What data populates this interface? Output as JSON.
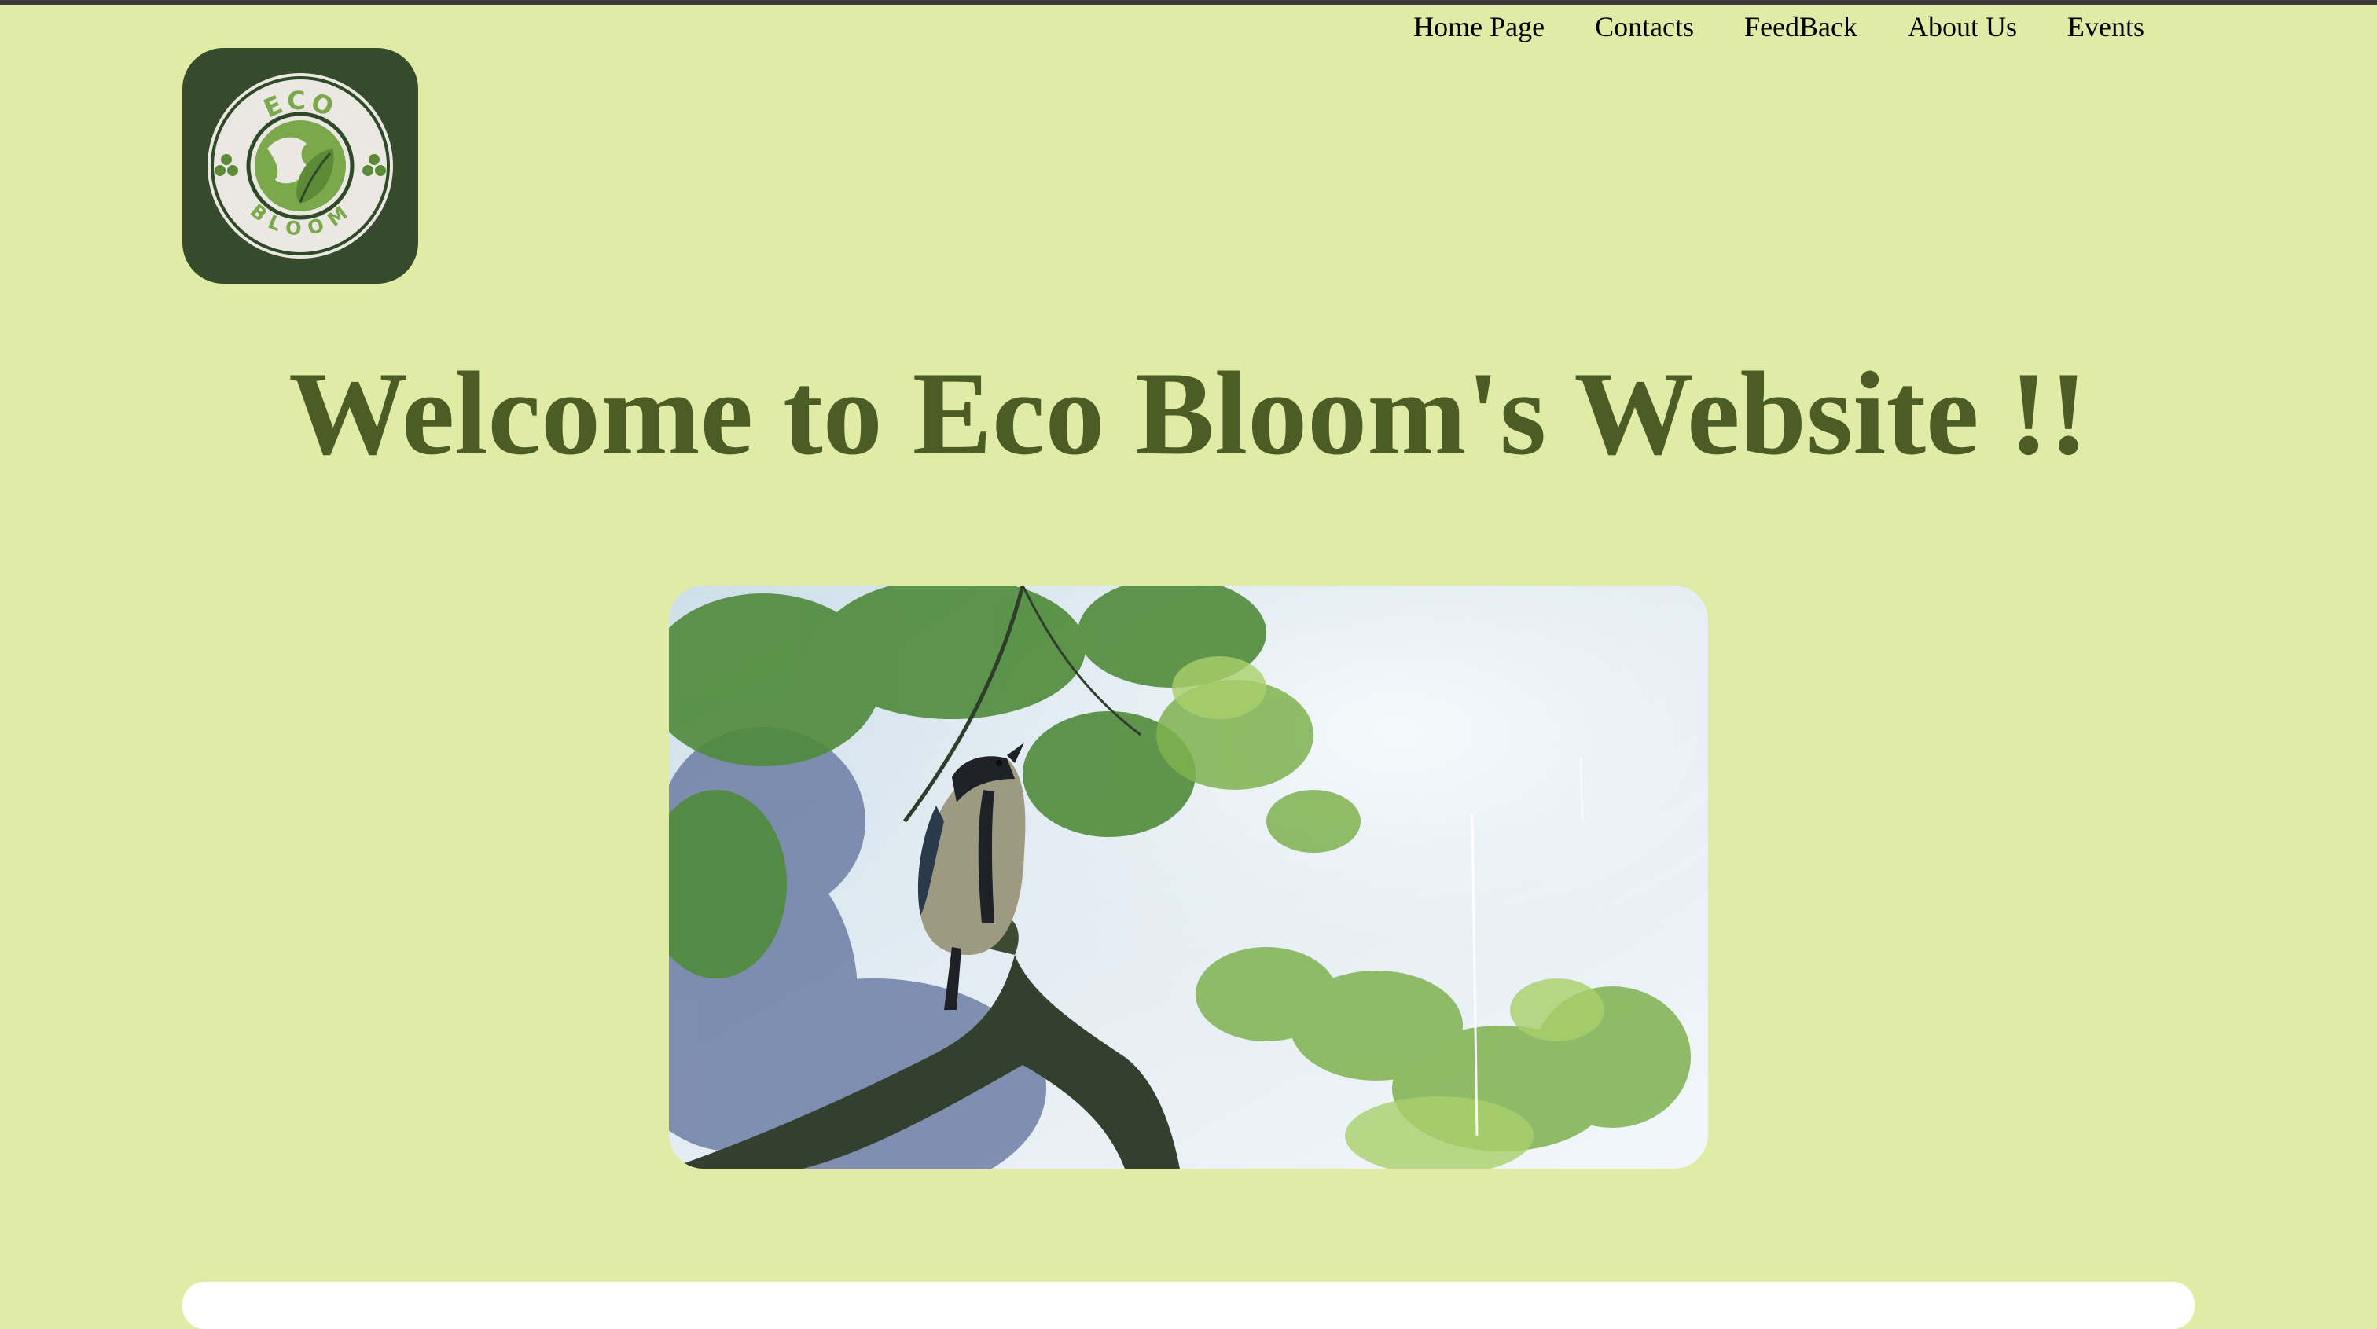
{
  "nav": {
    "items": [
      {
        "label": "Home Page"
      },
      {
        "label": "Contacts"
      },
      {
        "label": "FeedBack"
      },
      {
        "label": "About Us"
      },
      {
        "label": "Events"
      }
    ]
  },
  "logo": {
    "top_text": "ECO",
    "bottom_text": "BLOOM",
    "colors": {
      "tile": "#354b2c",
      "ring": "#2f4a26",
      "leaf": "#7aa84a",
      "text": "#7aa84a"
    }
  },
  "hero": {
    "heading": "Welcome to Eco Bloom's Website !!",
    "image_icon": "bird-on-branch-image"
  },
  "colors": {
    "background": "#e0eba6",
    "heading": "#4b5d25",
    "top_rule": "#3d3a37"
  }
}
